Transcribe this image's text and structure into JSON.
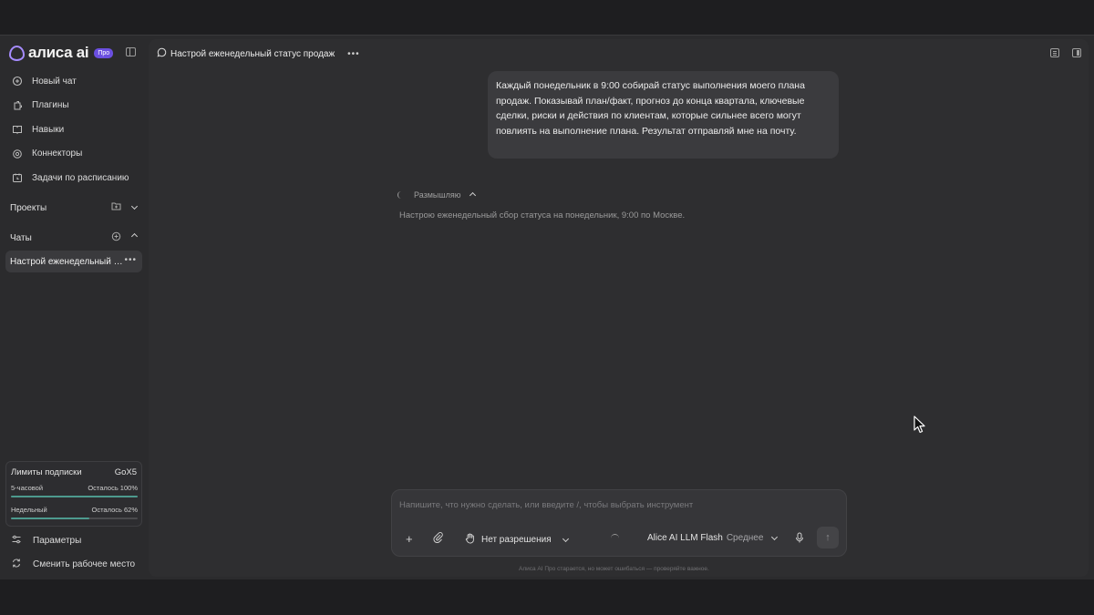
{
  "app": {
    "logo_text": "алиса ai",
    "badge": "Про"
  },
  "sidebar": {
    "nav": [
      {
        "label": "Новый чат",
        "icon": "chat-plus-icon"
      },
      {
        "label": "Плагины",
        "icon": "plugin-icon"
      },
      {
        "label": "Навыки",
        "icon": "book-icon"
      },
      {
        "label": "Коннекторы",
        "icon": "connector-icon"
      },
      {
        "label": "Задачи по расписанию",
        "icon": "calendar-icon"
      }
    ],
    "projects_label": "Проекты",
    "chats_label": "Чаты",
    "active_chat": "Настрой еженедельный статус продаж",
    "limits": {
      "title": "Лимиты подписки",
      "plan": "GoX5",
      "rows": [
        {
          "label": "5-часовой",
          "status": "Осталось 100%",
          "fraction": 1.0
        },
        {
          "label": "Недельный",
          "status": "Осталось 62%",
          "fraction": 0.62
        }
      ]
    },
    "bottom": [
      {
        "label": "Параметры",
        "icon": "sliders-icon"
      },
      {
        "label": "Сменить рабочее место",
        "icon": "switch-icon"
      }
    ]
  },
  "header": {
    "title": "Настрой еженедельный статус продаж"
  },
  "message": {
    "user_text": "Каждый понедельник в 9:00 собирай статус выполнения моего плана продаж. Показывай план/факт, прогноз до конца квартала, ключевые сделки, риски и действия по клиентам, которые сильнее всего могут повлиять на выполнение плана. Результат отправляй мне на почту."
  },
  "assistant": {
    "thinking_label": "Размышляю",
    "thinking_text": "Настрою еженедельный сбор статуса на понедельник, 9:00 по Москве."
  },
  "composer": {
    "placeholder": "Напишите, что нужно сделать, или введите /, чтобы выбрать инструмент",
    "permissions": "Нет разрешения",
    "model": "Alice AI LLM Flash",
    "model_mode": "Среднее"
  },
  "disclaimer": "Алиса AI Про старается, но может ошибаться — проверяйте важное."
}
